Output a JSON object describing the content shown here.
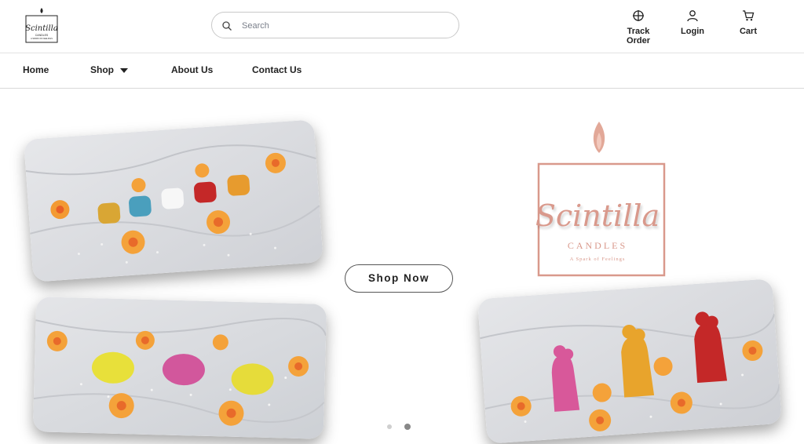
{
  "header": {
    "logo_alt": "Scintilla Candles",
    "search": {
      "placeholder": "Search"
    },
    "actions": [
      {
        "label": "Track Order",
        "icon": "crosshair-icon"
      },
      {
        "label": "Login",
        "icon": "user-icon"
      },
      {
        "label": "Cart",
        "icon": "cart-icon"
      }
    ]
  },
  "nav": {
    "items": [
      {
        "label": "Home"
      },
      {
        "label": "Shop",
        "has_dropdown": true
      },
      {
        "label": "About Us"
      },
      {
        "label": "Contact Us"
      }
    ]
  },
  "hero": {
    "cta_label": "Shop Now",
    "brand": {
      "name": "Scintilla",
      "sub": "CANDLES",
      "tagline": "A Spark of Feelings"
    },
    "slides": {
      "count": 2,
      "active_index": 1
    }
  },
  "colors": {
    "brand": "#d9998c",
    "text": "#222222",
    "border": "#c9c9c9"
  }
}
